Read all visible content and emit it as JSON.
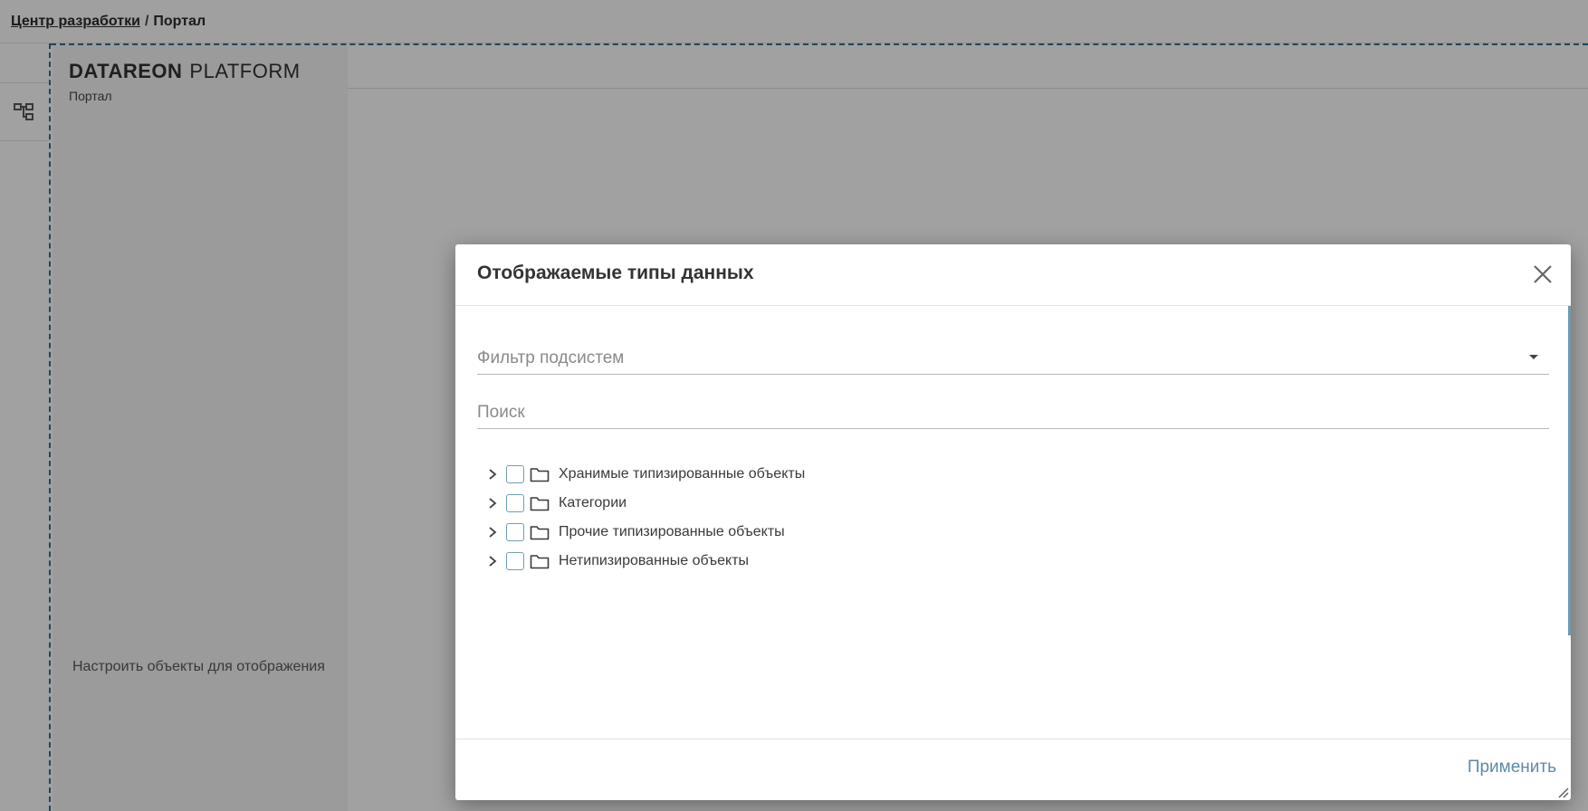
{
  "breadcrumb": {
    "link": "Центр разработки",
    "separator": "/",
    "current": "Портал"
  },
  "sidebar_icon": "hierarchy-icon",
  "panel": {
    "brand_bold": "DATAREON",
    "brand_light": "PLATFORM",
    "brand_subtitle": "Портал",
    "configure_link": "Настроить объекты для отображения"
  },
  "dialog": {
    "title": "Отображаемые типы данных",
    "filter_placeholder": "Фильтр подсистем",
    "search_placeholder": "Поиск",
    "tree_items": [
      {
        "label": "Хранимые типизированные объекты"
      },
      {
        "label": "Категории"
      },
      {
        "label": "Прочие типизированные объекты"
      },
      {
        "label": "Нетипизированные объекты"
      }
    ],
    "apply_label": "Применить"
  },
  "colors": {
    "accent": "#5c8aa8",
    "dashed_border": "#2d6d8c",
    "overlay": "rgba(0,0,0,0.34)"
  }
}
